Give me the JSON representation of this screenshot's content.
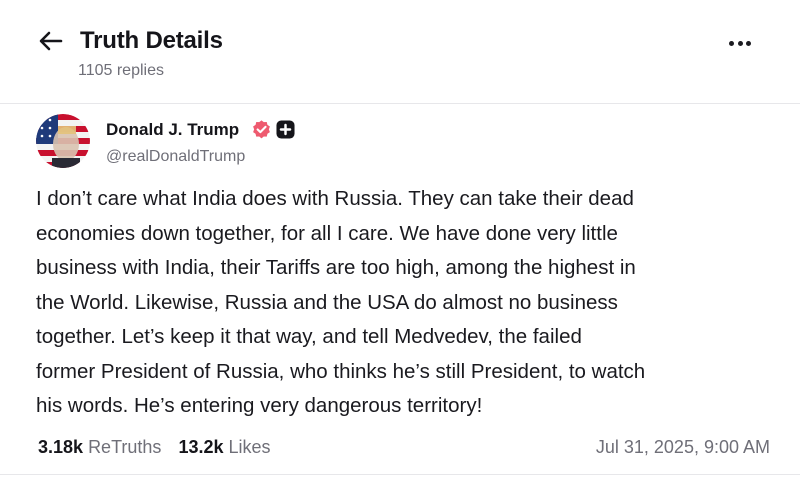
{
  "header": {
    "title": "Truth Details",
    "replies": "1105 replies"
  },
  "author": {
    "name": "Donald J. Trump",
    "handle": "@realDonaldTrump"
  },
  "post": {
    "lines": [
      "I don’t care what India does with Russia. They can take their dead",
      "economies down together, for all I care. We have done very little",
      "business with India, their Tariffs are too high, among the highest in",
      "the World. Likewise, Russia and the USA do almost no business",
      "together. Let’s keep it that way, and tell Medvedev, the failed",
      "former President of Russia, who thinks he’s still President, to watch",
      "his words. He’s entering very dangerous territory!"
    ]
  },
  "stats": {
    "retruths_count": "3.18k",
    "retruths_label": "ReTruths",
    "likes_count": "13.2k",
    "likes_label": "Likes",
    "timestamp": "Jul 31, 2025, 9:00 AM"
  },
  "icons": {
    "back": "arrow-left-icon",
    "more": "more-horizontal-icon",
    "verified": "verified-badge-icon",
    "plus": "plus-badge-icon"
  },
  "colors": {
    "verified": "#ee5a6f",
    "text_primary": "#15151a",
    "text_secondary": "#6f6f78"
  }
}
